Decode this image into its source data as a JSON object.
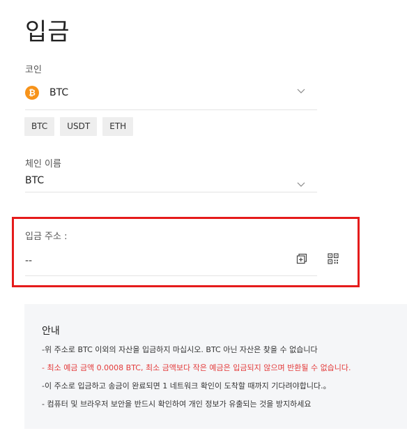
{
  "page": {
    "title": "입금"
  },
  "coin": {
    "label": "코인",
    "selected": "BTC",
    "icon": "bitcoin-icon",
    "chips": [
      "BTC",
      "USDT",
      "ETH"
    ]
  },
  "chain": {
    "label": "체인 이름",
    "selected": "BTC"
  },
  "deposit_address": {
    "label": "입금 주소 :",
    "value": "--",
    "copy_icon": "copy-icon",
    "qr_icon": "qr-code-icon"
  },
  "notice": {
    "title": "안내",
    "lines": [
      "-위 주소로 BTC 이외의 자산을 입금하지 마십시오. BTC 아닌 자산은 찾을 수 없습니다",
      "- 최소 예금 금액 0.0008 BTC, 최소 금액보다 작은 예금은 입금되지 않으며 반환될 수 없습니다.",
      "-이 주소로 입금하고 송금이 완료되면 1 네트워크 확인이 도착할 때까지 기다려야합니다.。",
      "- 컴퓨터 및 브라우저 보안을 반드시 확인하여 개인 정보가 유출되는 것을 방지하세요"
    ]
  },
  "colors": {
    "highlight": "#e51b1b",
    "warning_text": "#e33a3a",
    "btc_orange": "#f7931a"
  }
}
